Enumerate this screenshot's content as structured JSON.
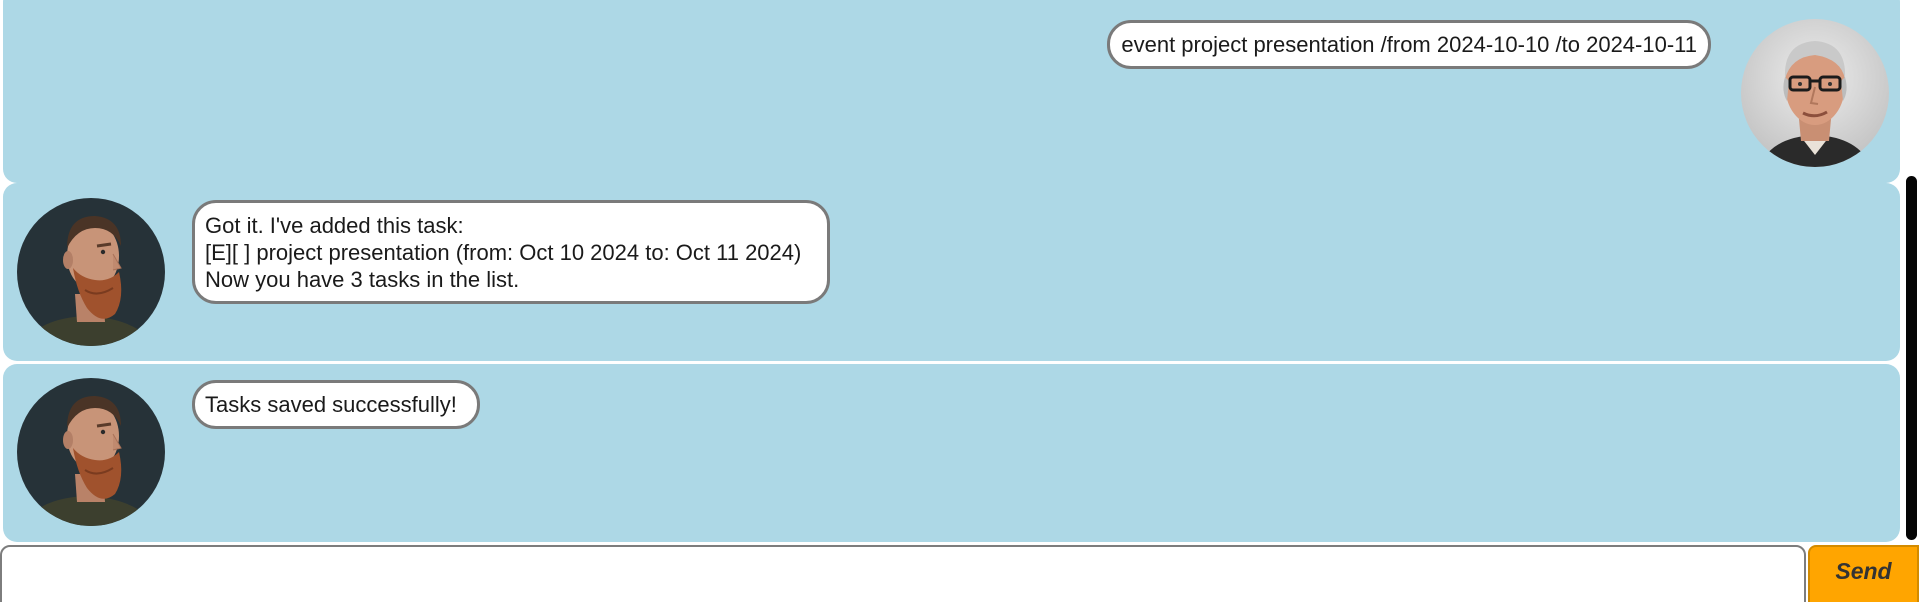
{
  "chat": {
    "messages": [
      {
        "sender": "user",
        "avatar_icon": "user-portrait-icon",
        "lines": [
          "event project presentation /from 2024-10-10 /to 2024-10-11"
        ]
      },
      {
        "sender": "bot",
        "avatar_icon": "bot-portrait-icon",
        "lines": [
          "Got it. I've added this task:",
          "[E][ ] project presentation (from: Oct 10 2024 to: Oct 11 2024)",
          "Now you have 3 tasks in the list."
        ]
      },
      {
        "sender": "bot",
        "avatar_icon": "bot-portrait-icon",
        "lines": [
          "Tasks saved successfully!"
        ]
      }
    ]
  },
  "input": {
    "value": "",
    "send_label": "Send"
  },
  "colors": {
    "dialog_background": "#add8e6",
    "bubble_background": "#ffffff",
    "bubble_border": "#7a7a7a",
    "send_button": "#ffa500",
    "scrollbar_thumb": "#050505"
  }
}
